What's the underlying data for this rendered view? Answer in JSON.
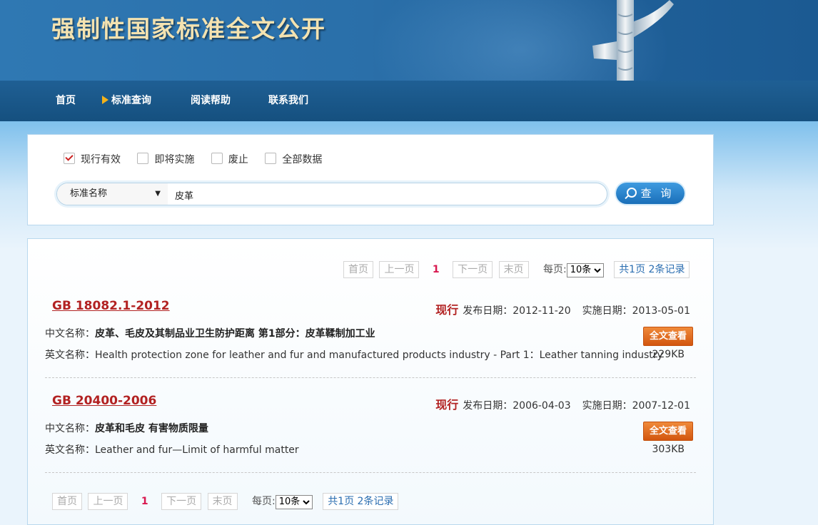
{
  "header": {
    "title": "强制性国家标准全文公开"
  },
  "nav": [
    {
      "label": "首页",
      "active": false
    },
    {
      "label": "标准查询",
      "active": true
    },
    {
      "label": "阅读帮助",
      "active": false
    },
    {
      "label": "联系我们",
      "active": false
    }
  ],
  "filters": [
    {
      "label": "现行有效",
      "checked": true
    },
    {
      "label": "即将实施",
      "checked": false
    },
    {
      "label": "废止",
      "checked": false
    },
    {
      "label": "全部数据",
      "checked": false
    }
  ],
  "search": {
    "field": "标准名称",
    "keyword": "皮革",
    "button_label": "查 询"
  },
  "pagination": {
    "first": "首页",
    "prev": "上一页",
    "current": "1",
    "next": "下一页",
    "last": "末页",
    "per_page_label": "每页:",
    "per_page_value": "10条",
    "summary": "共1页 2条记录"
  },
  "labels": {
    "publish_date": "发布日期：",
    "implement_date": "实施日期：",
    "cn_name": "中文名称：",
    "en_name": "英文名称：",
    "view_button": "全文查看"
  },
  "records": [
    {
      "code": "GB 18082.1-2012",
      "status": "现行",
      "publish_date": "2012-11-20",
      "implement_date": "2013-05-01",
      "cn_name": "皮革、毛皮及其制品业卫生防护距离 第1部分：皮革鞣制加工业",
      "en_name": "Health protection zone for leather and fur and manufactured products industry - Part 1：Leather tanning industry",
      "size": "229KB"
    },
    {
      "code": "GB 20400-2006",
      "status": "现行",
      "publish_date": "2006-04-03",
      "implement_date": "2007-12-01",
      "cn_name": "皮革和毛皮 有害物质限量",
      "en_name": "Leather and fur—Limit of harmful matter",
      "size": "303KB"
    }
  ]
}
